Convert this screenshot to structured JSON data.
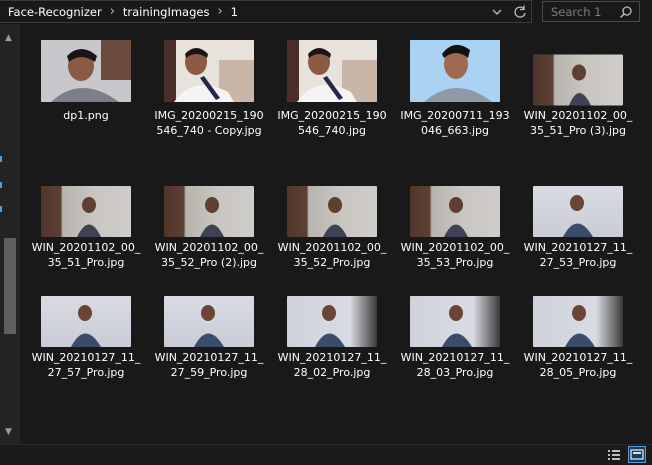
{
  "breadcrumb": {
    "items": [
      "Face-Recognizer",
      "trainingImages",
      "1"
    ],
    "separator": "›"
  },
  "search": {
    "placeholder": "Search 1"
  },
  "icons": {
    "address_dropdown": "chevron-down-icon",
    "refresh": "refresh-icon",
    "search": "search-icon",
    "details_view": "details-view-icon",
    "large_icons_view": "large-icons-view-icon"
  },
  "files": [
    {
      "name": "dp1.png"
    },
    {
      "name": "IMG_20200215_190546_740 - Copy.jpg"
    },
    {
      "name": "IMG_20200215_190546_740.jpg"
    },
    {
      "name": "IMG_20200711_193046_663.jpg"
    },
    {
      "name": "WIN_20201102_00_35_51_Pro (3).jpg"
    },
    {
      "name": "WIN_20201102_00_35_51_Pro.jpg"
    },
    {
      "name": "WIN_20201102_00_35_52_Pro (2).jpg"
    },
    {
      "name": "WIN_20201102_00_35_52_Pro.jpg"
    },
    {
      "name": "WIN_20201102_00_35_53_Pro.jpg"
    },
    {
      "name": "WIN_20210127_11_27_53_Pro.jpg"
    },
    {
      "name": "WIN_20210127_11_27_57_Pro.jpg"
    },
    {
      "name": "WIN_20210127_11_27_59_Pro.jpg"
    },
    {
      "name": "WIN_20210127_11_28_02_Pro.jpg"
    },
    {
      "name": "WIN_20210127_11_28_03_Pro.jpg"
    },
    {
      "name": "WIN_20210127_11_28_05_Pro.jpg"
    }
  ],
  "colors": {
    "background": "#191919",
    "text": "#ffffff",
    "accent": "#5a9bd6"
  }
}
